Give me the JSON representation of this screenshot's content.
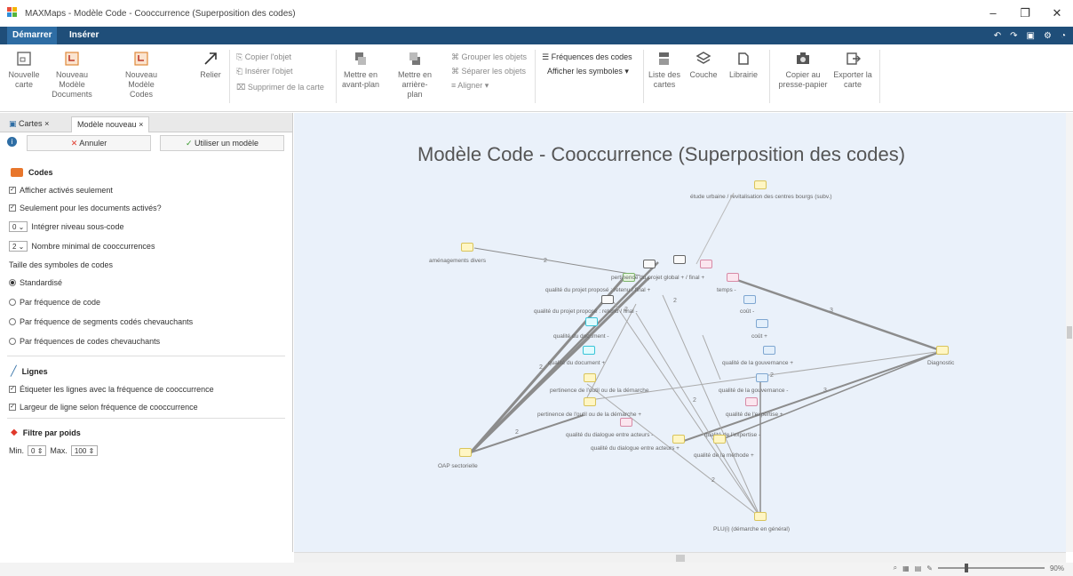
{
  "window": {
    "title": "MAXMaps - Modèle Code - Cooccurrence (Superposition des codes)",
    "controls": {
      "minimize": "–",
      "maximize": "❐",
      "close": "✕"
    }
  },
  "ribbon_tabs": [
    {
      "label": "Démarrer",
      "active": true
    },
    {
      "label": "Insérer",
      "active": false
    }
  ],
  "ribbon": {
    "new_map": "Nouvelle carte",
    "new_model_docs": "Nouveau Modèle Documents",
    "new_model_codes": "Nouveau Modèle Codes",
    "link": "Relier",
    "copy_object": "Copier l'objet",
    "insert_object": "Insérer l'objet",
    "delete_from_map": "Supprimer de la carte",
    "bring_front": "Mettre en avant-plan",
    "send_back": "Mettre en arrière-plan",
    "group_objects": "Grouper les objets",
    "separate_objects": "Séparer les objets",
    "align": "Aligner",
    "code_frequencies": "Fréquences des codes",
    "show_symbols": "Afficher les symboles",
    "map_list": "Liste des cartes",
    "layer": "Couche",
    "library": "Librairie",
    "copy_clipboard": "Copier au presse-papier",
    "export_map": "Exporter la carte"
  },
  "left_panel": {
    "tabs": [
      {
        "label": "Cartes",
        "closable": true
      },
      {
        "label": "Modèle nouveau",
        "closable": true
      }
    ],
    "cancel_button": "Annuler",
    "use_model_button": "Utiliser un modèle",
    "codes_section": {
      "title": "Codes",
      "show_active_only": "Afficher activés seulement",
      "only_active_docs": "Seulement pour les documents activés?",
      "subcode_level_value": "0",
      "subcode_level_label": "Intégrer niveau sous-code",
      "min_cooc_value": "2",
      "min_cooc_label": "Nombre minimal de cooccurrences",
      "symbol_size_label": "Taille des symboles de codes",
      "size_options": [
        {
          "label": "Standardisé",
          "selected": true
        },
        {
          "label": "Par fréquence de code",
          "selected": false
        },
        {
          "label": "Par fréquence de segments codés chevauchants",
          "selected": false
        },
        {
          "label": "Par fréquences de codes chevauchants",
          "selected": false
        }
      ]
    },
    "lines_section": {
      "title": "Lignes",
      "label_lines": "Étiqueter les lignes avec la fréquence de cooccurrence",
      "width_by_freq": "Largeur de ligne selon fréquence de cooccurrence"
    },
    "weight_filter": {
      "title": "Filtre par poids",
      "min_label": "Min.",
      "min_value": "0",
      "max_label": "Max.",
      "max_value": "100"
    }
  },
  "map": {
    "title": "Modèle Code - Cooccurrence (Superposition des codes)",
    "nodes": [
      {
        "id": "etude",
        "label": "étude urbaine / revitalisation des centres bourgs (subv.)",
        "color": "y"
      },
      {
        "id": "amenag",
        "label": "aménagements divers",
        "color": "y"
      },
      {
        "id": "pert_proj",
        "label": "pertinence du projet global + / final +",
        "color": "g"
      },
      {
        "id": "qpp_plus",
        "label": "qualité du projet proposé : retenu / final +",
        "color": "w"
      },
      {
        "id": "temps",
        "label": "temps -",
        "color": "p"
      },
      {
        "id": "qpp_minus",
        "label": "qualité du projet proposé : retenu / final -",
        "color": "w"
      },
      {
        "id": "cout_minus",
        "label": "coût -",
        "color": "b"
      },
      {
        "id": "cout_plus",
        "label": "coût +",
        "color": "b"
      },
      {
        "id": "qdoc_minus",
        "label": "qualité du document -",
        "color": "c"
      },
      {
        "id": "qdoc_plus",
        "label": "qualité du document +",
        "color": "c"
      },
      {
        "id": "qgouv_plus",
        "label": "qualité de la gouvernance +",
        "color": "b"
      },
      {
        "id": "diagnostic",
        "label": "Diagnostic",
        "color": "y"
      },
      {
        "id": "pert_outil_minus",
        "label": "pertinence de l'outil ou de la démarche",
        "color": "y"
      },
      {
        "id": "qgouv_minus",
        "label": "qualité de la gouvernance -",
        "color": "b"
      },
      {
        "id": "pert_outil_plus",
        "label": "pertinence de l'outil ou de la démarche +",
        "color": "y"
      },
      {
        "id": "qexp_plus",
        "label": "qualité de l'expertise +",
        "color": "p"
      },
      {
        "id": "qdial_minus",
        "label": "qualité du dialogue entre acteurs -",
        "color": "p"
      },
      {
        "id": "qexp_minus",
        "label": "qualité de l'expertise -",
        "color": "y"
      },
      {
        "id": "qdial_plus",
        "label": "qualité du dialogue entre acteurs +",
        "color": "y"
      },
      {
        "id": "qmeth",
        "label": "qualité de la méthode +",
        "color": "y"
      },
      {
        "id": "oap",
        "label": "OAP sectorielle",
        "color": "y"
      },
      {
        "id": "plui",
        "label": "PLU(i) (démarche en général)",
        "color": "y"
      }
    ],
    "edge_labels": [
      "2",
      "2",
      "2",
      "2",
      "2",
      "2",
      "2",
      "3",
      "3",
      "2"
    ]
  },
  "statusbar": {
    "zoom": "90%"
  }
}
